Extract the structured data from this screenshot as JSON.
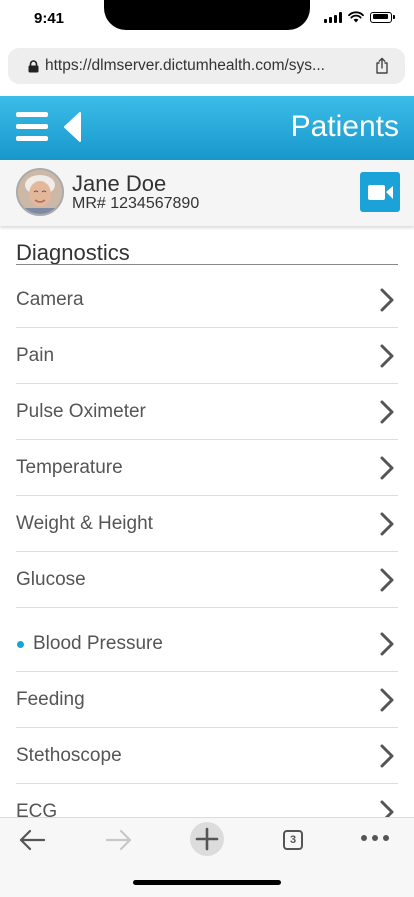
{
  "status_bar": {
    "time": "9:41"
  },
  "browser": {
    "url": "https://dlmserver.dictumhealth.com/sys..."
  },
  "header": {
    "title": "Patients"
  },
  "patient": {
    "name": "Jane Doe",
    "mr": "MR# 1234567890"
  },
  "diagnostics": {
    "title": "Diagnostics",
    "items": [
      {
        "label": "Camera"
      },
      {
        "label": "Pain"
      },
      {
        "label": "Pulse Oximeter"
      },
      {
        "label": "Temperature"
      },
      {
        "label": "Weight & Height"
      },
      {
        "label": "Glucose"
      },
      {
        "label": "Blood Pressure"
      },
      {
        "label": "Feeding"
      },
      {
        "label": "Stethoscope"
      },
      {
        "label": "ECG"
      }
    ]
  },
  "toolbar": {
    "tab_count": "3"
  },
  "colors": {
    "accent": "#1ba2d8",
    "header_top": "#3cbde8",
    "header_bottom": "#1897cc"
  },
  "icons": {
    "menu": "hamburger-icon",
    "back": "back-triangle-icon",
    "video": "video-camera-icon",
    "chevron": "chevron-right-icon",
    "lock": "lock-icon",
    "share": "share-icon",
    "back_nav": "arrow-left-icon",
    "forward_nav": "arrow-right-icon",
    "new_tab": "plus-icon",
    "more": "ellipsis-icon"
  }
}
